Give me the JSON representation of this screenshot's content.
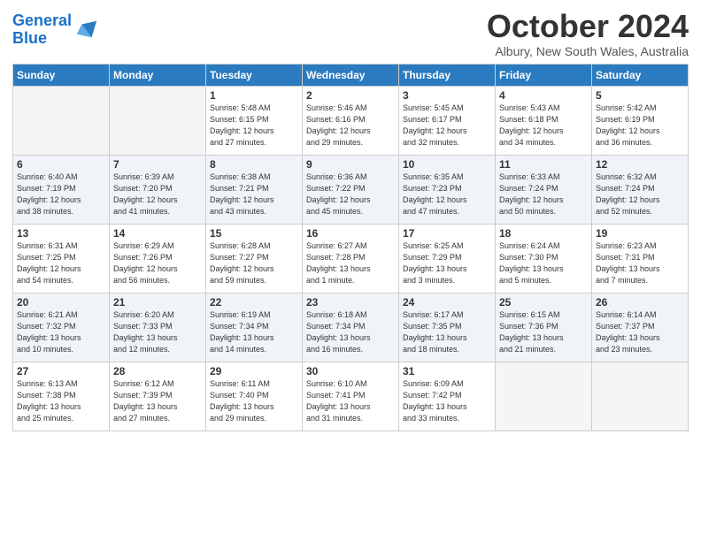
{
  "logo": {
    "line1": "General",
    "line2": "Blue"
  },
  "title": "October 2024",
  "subtitle": "Albury, New South Wales, Australia",
  "headers": [
    "Sunday",
    "Monday",
    "Tuesday",
    "Wednesday",
    "Thursday",
    "Friday",
    "Saturday"
  ],
  "weeks": [
    [
      {
        "day": "",
        "info": ""
      },
      {
        "day": "",
        "info": ""
      },
      {
        "day": "1",
        "info": "Sunrise: 5:48 AM\nSunset: 6:15 PM\nDaylight: 12 hours\nand 27 minutes."
      },
      {
        "day": "2",
        "info": "Sunrise: 5:46 AM\nSunset: 6:16 PM\nDaylight: 12 hours\nand 29 minutes."
      },
      {
        "day": "3",
        "info": "Sunrise: 5:45 AM\nSunset: 6:17 PM\nDaylight: 12 hours\nand 32 minutes."
      },
      {
        "day": "4",
        "info": "Sunrise: 5:43 AM\nSunset: 6:18 PM\nDaylight: 12 hours\nand 34 minutes."
      },
      {
        "day": "5",
        "info": "Sunrise: 5:42 AM\nSunset: 6:19 PM\nDaylight: 12 hours\nand 36 minutes."
      }
    ],
    [
      {
        "day": "6",
        "info": "Sunrise: 6:40 AM\nSunset: 7:19 PM\nDaylight: 12 hours\nand 38 minutes."
      },
      {
        "day": "7",
        "info": "Sunrise: 6:39 AM\nSunset: 7:20 PM\nDaylight: 12 hours\nand 41 minutes."
      },
      {
        "day": "8",
        "info": "Sunrise: 6:38 AM\nSunset: 7:21 PM\nDaylight: 12 hours\nand 43 minutes."
      },
      {
        "day": "9",
        "info": "Sunrise: 6:36 AM\nSunset: 7:22 PM\nDaylight: 12 hours\nand 45 minutes."
      },
      {
        "day": "10",
        "info": "Sunrise: 6:35 AM\nSunset: 7:23 PM\nDaylight: 12 hours\nand 47 minutes."
      },
      {
        "day": "11",
        "info": "Sunrise: 6:33 AM\nSunset: 7:24 PM\nDaylight: 12 hours\nand 50 minutes."
      },
      {
        "day": "12",
        "info": "Sunrise: 6:32 AM\nSunset: 7:24 PM\nDaylight: 12 hours\nand 52 minutes."
      }
    ],
    [
      {
        "day": "13",
        "info": "Sunrise: 6:31 AM\nSunset: 7:25 PM\nDaylight: 12 hours\nand 54 minutes."
      },
      {
        "day": "14",
        "info": "Sunrise: 6:29 AM\nSunset: 7:26 PM\nDaylight: 12 hours\nand 56 minutes."
      },
      {
        "day": "15",
        "info": "Sunrise: 6:28 AM\nSunset: 7:27 PM\nDaylight: 12 hours\nand 59 minutes."
      },
      {
        "day": "16",
        "info": "Sunrise: 6:27 AM\nSunset: 7:28 PM\nDaylight: 13 hours\nand 1 minute."
      },
      {
        "day": "17",
        "info": "Sunrise: 6:25 AM\nSunset: 7:29 PM\nDaylight: 13 hours\nand 3 minutes."
      },
      {
        "day": "18",
        "info": "Sunrise: 6:24 AM\nSunset: 7:30 PM\nDaylight: 13 hours\nand 5 minutes."
      },
      {
        "day": "19",
        "info": "Sunrise: 6:23 AM\nSunset: 7:31 PM\nDaylight: 13 hours\nand 7 minutes."
      }
    ],
    [
      {
        "day": "20",
        "info": "Sunrise: 6:21 AM\nSunset: 7:32 PM\nDaylight: 13 hours\nand 10 minutes."
      },
      {
        "day": "21",
        "info": "Sunrise: 6:20 AM\nSunset: 7:33 PM\nDaylight: 13 hours\nand 12 minutes."
      },
      {
        "day": "22",
        "info": "Sunrise: 6:19 AM\nSunset: 7:34 PM\nDaylight: 13 hours\nand 14 minutes."
      },
      {
        "day": "23",
        "info": "Sunrise: 6:18 AM\nSunset: 7:34 PM\nDaylight: 13 hours\nand 16 minutes."
      },
      {
        "day": "24",
        "info": "Sunrise: 6:17 AM\nSunset: 7:35 PM\nDaylight: 13 hours\nand 18 minutes."
      },
      {
        "day": "25",
        "info": "Sunrise: 6:15 AM\nSunset: 7:36 PM\nDaylight: 13 hours\nand 21 minutes."
      },
      {
        "day": "26",
        "info": "Sunrise: 6:14 AM\nSunset: 7:37 PM\nDaylight: 13 hours\nand 23 minutes."
      }
    ],
    [
      {
        "day": "27",
        "info": "Sunrise: 6:13 AM\nSunset: 7:38 PM\nDaylight: 13 hours\nand 25 minutes."
      },
      {
        "day": "28",
        "info": "Sunrise: 6:12 AM\nSunset: 7:39 PM\nDaylight: 13 hours\nand 27 minutes."
      },
      {
        "day": "29",
        "info": "Sunrise: 6:11 AM\nSunset: 7:40 PM\nDaylight: 13 hours\nand 29 minutes."
      },
      {
        "day": "30",
        "info": "Sunrise: 6:10 AM\nSunset: 7:41 PM\nDaylight: 13 hours\nand 31 minutes."
      },
      {
        "day": "31",
        "info": "Sunrise: 6:09 AM\nSunset: 7:42 PM\nDaylight: 13 hours\nand 33 minutes."
      },
      {
        "day": "",
        "info": ""
      },
      {
        "day": "",
        "info": ""
      }
    ]
  ]
}
